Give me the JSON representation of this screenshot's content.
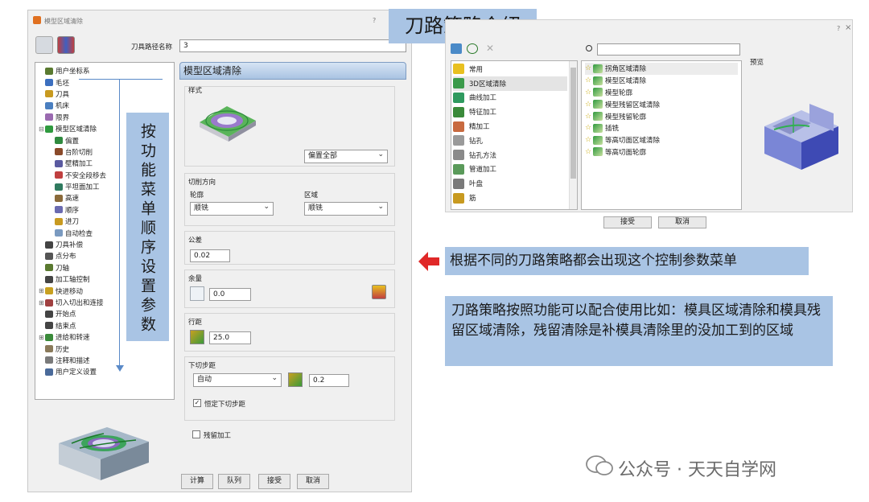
{
  "left_dialog": {
    "title": "模型区域清除",
    "help": "?",
    "toolpath_name_label": "刀具路径名称",
    "toolpath_name_value": "3",
    "tree": [
      {
        "label": "用户坐标系",
        "color": "#5a7a30",
        "indent": 0
      },
      {
        "label": "毛坯",
        "color": "#3c6fbf",
        "indent": 0
      },
      {
        "label": "刀具",
        "color": "#c89a20",
        "indent": 0
      },
      {
        "label": "机床",
        "color": "#4a7fc0",
        "indent": 0
      },
      {
        "label": "限界",
        "color": "#9a6ab0",
        "indent": 0
      },
      {
        "label": "模型区域清除",
        "color": "#2f9a3f",
        "indent": 0,
        "expander": "⊟"
      },
      {
        "label": "偏置",
        "color": "#2f8a3f",
        "indent": 1
      },
      {
        "label": "台阶切削",
        "color": "#8a4a2a",
        "indent": 1
      },
      {
        "label": "壁精加工",
        "color": "#5a5aa0",
        "indent": 1
      },
      {
        "label": "不安全段移去",
        "color": "#c04040",
        "indent": 1
      },
      {
        "label": "平坦面加工",
        "color": "#2f7a5f",
        "indent": 1
      },
      {
        "label": "高速",
        "color": "#8a6a3a",
        "indent": 1
      },
      {
        "label": "顺序",
        "color": "#6a6ab0",
        "indent": 1
      },
      {
        "label": "进刀",
        "color": "#c89a20",
        "indent": 1
      },
      {
        "label": "自动检查",
        "color": "#7a9ac0",
        "indent": 1
      },
      {
        "label": "刀具补偿",
        "color": "#444444",
        "indent": 0
      },
      {
        "label": "点分布",
        "color": "#555555",
        "indent": 0
      },
      {
        "label": "刀轴",
        "color": "#5a7a30",
        "indent": 0
      },
      {
        "label": "加工轴控制",
        "color": "#444444",
        "indent": 0
      },
      {
        "label": "快进移动",
        "color": "#c8a020",
        "indent": 0,
        "expander": "⊞"
      },
      {
        "label": "切入切出和连接",
        "color": "#a04040",
        "indent": 0,
        "expander": "⊞"
      },
      {
        "label": "开始点",
        "color": "#444444",
        "indent": 0
      },
      {
        "label": "结束点",
        "color": "#444444",
        "indent": 0
      },
      {
        "label": "进给和转速",
        "color": "#3a8a3a",
        "indent": 0,
        "expander": "⊞"
      },
      {
        "label": "历史",
        "color": "#8a7a5a",
        "indent": 0
      },
      {
        "label": "注释和描述",
        "color": "#7a7a7a",
        "indent": 0
      },
      {
        "label": "用户定义设置",
        "color": "#4a6a9a",
        "indent": 0
      }
    ],
    "panel_title": "模型区域清除",
    "style_label": "样式",
    "style_value": "偏置全部",
    "cut_direction_label": "切削方向",
    "profile_label": "轮廓",
    "profile_value": "顺铣",
    "area_label": "区域",
    "area_value": "顺铣",
    "tolerance_label": "公差",
    "tolerance_value": "0.02",
    "allowance_label": "余量",
    "allowance_value": "0.0",
    "stepover_label": "行距",
    "stepover_value": "25.0",
    "stepdown_label": "下切步距",
    "stepdown_mode": "自动",
    "stepdown_value": "0.2",
    "constant_stepdown_label": "恒定下切步距",
    "constant_stepdown_checked": true,
    "rest_machining_label": "残留加工",
    "rest_machining_checked": false,
    "buttons": [
      "计算",
      "队列",
      "接受",
      "取消"
    ]
  },
  "right_dialog": {
    "help": "?",
    "close": "×",
    "search_value": "",
    "categories": [
      {
        "label": "常用",
        "color": "#e8c020"
      },
      {
        "label": "3D区域清除",
        "color": "#3a9a4a"
      },
      {
        "label": "曲线加工",
        "color": "#2f9a5f"
      },
      {
        "label": "特征加工",
        "color": "#3a8a3a"
      },
      {
        "label": "精加工",
        "color": "#c86a40"
      },
      {
        "label": "钻孔",
        "color": "#9a9a9a"
      },
      {
        "label": "钻孔方法",
        "color": "#8a8a8a"
      },
      {
        "label": "管道加工",
        "color": "#5a9a5a"
      },
      {
        "label": "叶盘",
        "color": "#7a7a7a"
      },
      {
        "label": "筋",
        "color": "#c89a20"
      }
    ],
    "strategies": [
      "拐角区域清除",
      "模型区域清除",
      "模型轮廓",
      "模型残留区域清除",
      "模型残留轮廓",
      "插铣",
      "等高切面区域清除",
      "等高切面轮廓"
    ],
    "preview_label": "预览",
    "buttons": [
      "接受",
      "取消"
    ]
  },
  "annotations": {
    "title": "刀路策略介绍",
    "vertical_note": "按功能菜单顺序设置参数",
    "arrow_note": "根据不同的刀路策略都会出现这个控制参数菜单",
    "combo_note": "刀路策略按照功能可以配合使用比如：模具区域清除和模具残留区域清除，残留清除是补模具清除里的没加工到的区域"
  },
  "watermark": "公众号 · 天天自学网"
}
